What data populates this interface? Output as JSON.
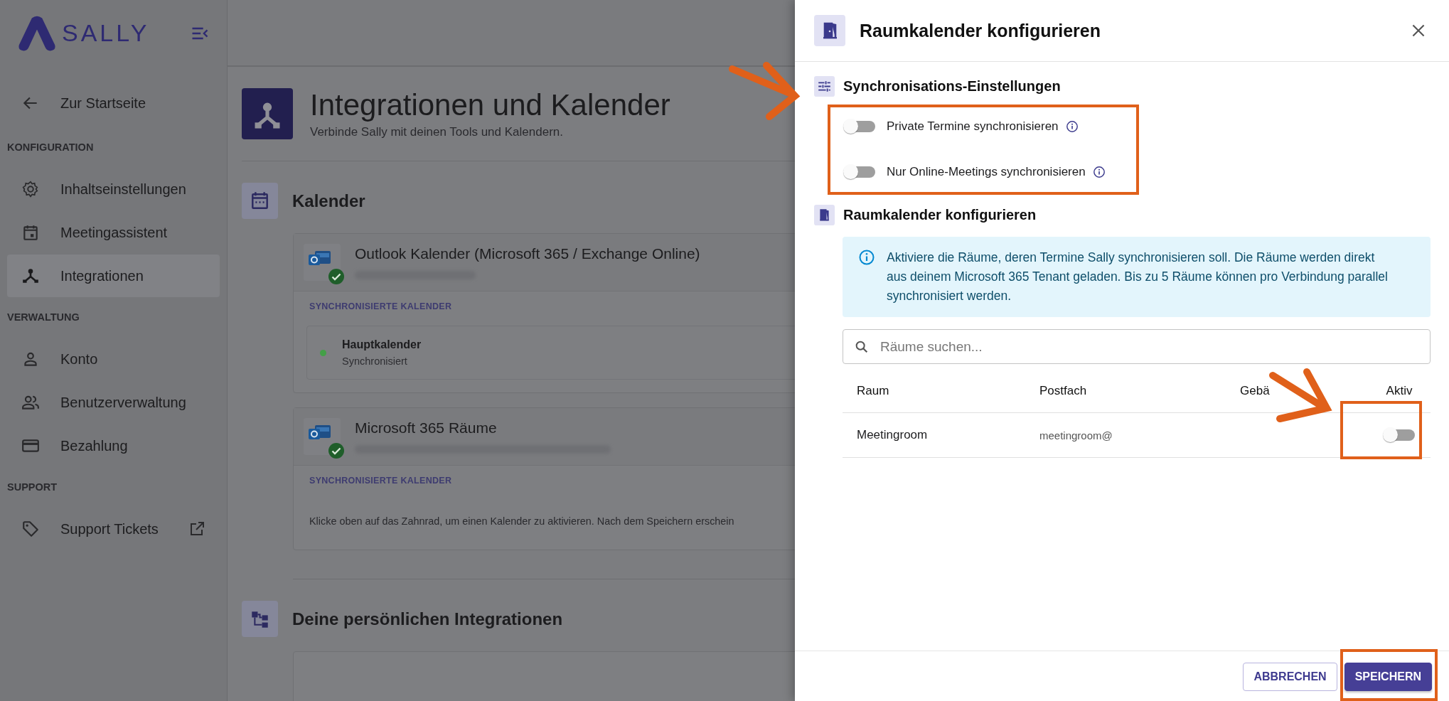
{
  "sidebar": {
    "logo": "SALLY",
    "back": {
      "label": "Zur Startseite"
    },
    "sections": [
      {
        "heading": "KONFIGURATION",
        "items": [
          {
            "label": "Inhaltseinstellungen",
            "selected": false,
            "external": false
          },
          {
            "label": "Meetingassistent",
            "selected": false,
            "external": false
          },
          {
            "label": "Integrationen",
            "selected": true,
            "external": false
          }
        ]
      },
      {
        "heading": "VERWALTUNG",
        "items": [
          {
            "label": "Konto",
            "selected": false,
            "external": false
          },
          {
            "label": "Benutzerverwaltung",
            "selected": false,
            "external": false
          },
          {
            "label": "Bezahlung",
            "selected": false,
            "external": false
          }
        ]
      },
      {
        "heading": "SUPPORT",
        "items": [
          {
            "label": "Support Tickets",
            "selected": false,
            "external": true
          }
        ]
      }
    ]
  },
  "page": {
    "title": "Integrationen und Kalender",
    "subtitle": "Verbinde Sally mit deinen Tools und Kalendern.",
    "sections": [
      {
        "kind": "calendars",
        "title": "Kalender",
        "cards": [
          {
            "name": "Outlook Kalender (Microsoft 365 / Exchange Online)",
            "connected": true,
            "list_heading": "SYNCHRONISIERTE KALENDER",
            "calendars": [
              {
                "name": "Hauptkalender",
                "status": "Synchronisiert",
                "color": "#43a047"
              }
            ]
          },
          {
            "name": "Microsoft 365 Räume",
            "connected": true,
            "list_heading": "SYNCHRONISIERTE KALENDER",
            "hint": "Klicke oben auf das Zahnrad, um einen Kalender zu aktivieren. Nach dem Speichern erschein"
          }
        ]
      },
      {
        "kind": "integrations",
        "title": "Deine persönlichen Integrationen"
      }
    ]
  },
  "drawer": {
    "title": "Raumkalender konfigurieren",
    "sync": {
      "title": "Synchronisations-Einstellungen",
      "options": [
        {
          "label": "Private Termine synchronisieren",
          "on": false
        },
        {
          "label": "Nur Online-Meetings synchronisieren",
          "on": false
        }
      ]
    },
    "rooms": {
      "title": "Raumkalender konfigurieren",
      "info": "Aktiviere die Räume, deren Termine Sally synchronisieren soll. Die Räume werden direkt aus deinem Microsoft 365 Tenant geladen. Bis zu 5 Räume können pro Verbindung parallel synchronisiert werden.",
      "search": {
        "placeholder": "Räume suchen..."
      },
      "columns": [
        "Raum",
        "Postfach",
        "Gebä",
        "Aktiv"
      ],
      "rows": [
        {
          "room": "Meetingroom",
          "mailbox": "meetingroom@",
          "active": false
        }
      ]
    },
    "buttons": [
      {
        "label": "ABBRECHEN",
        "kind": "secondary"
      },
      {
        "label": "SPEICHERN",
        "kind": "primary"
      }
    ]
  }
}
